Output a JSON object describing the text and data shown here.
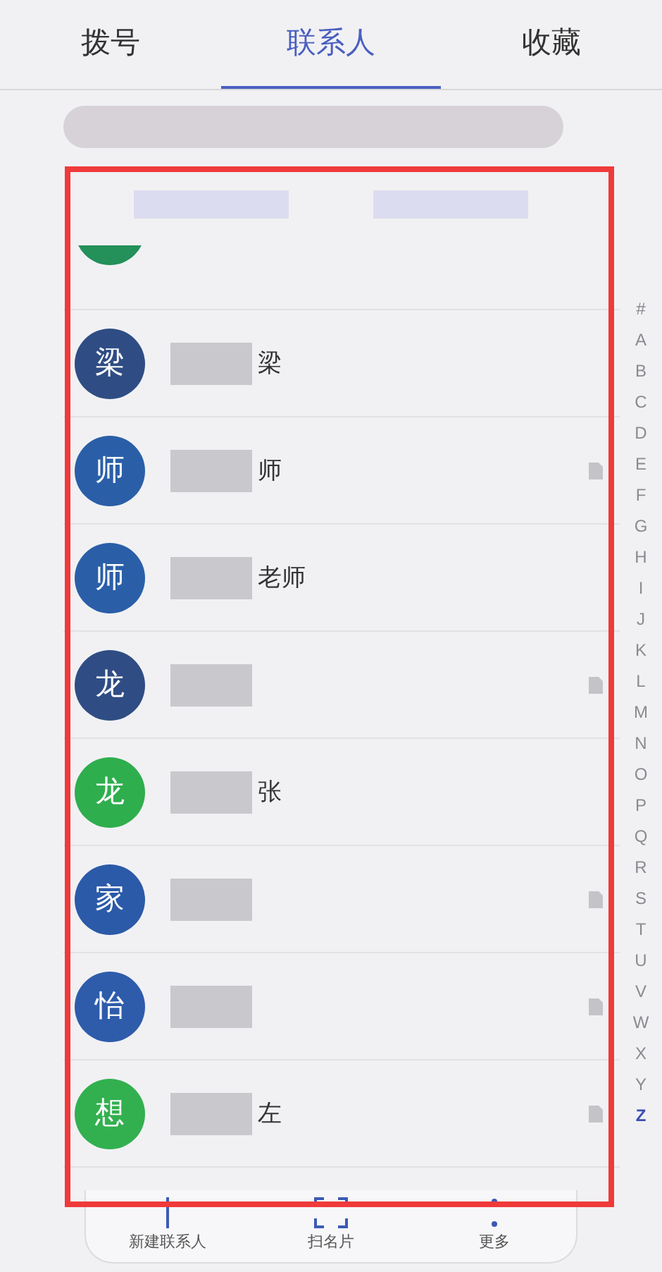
{
  "tabs": [
    {
      "label": "拨号",
      "selected": false
    },
    {
      "label": "联系人",
      "selected": true
    },
    {
      "label": "收藏",
      "selected": false
    }
  ],
  "partial_row": {
    "color": "#24905a"
  },
  "contacts": [
    {
      "avatar": "梁",
      "color": "#2f4d84",
      "name": "梁",
      "card": false
    },
    {
      "avatar": "师",
      "color": "#2a5fa8",
      "name": "师",
      "card": true
    },
    {
      "avatar": "师",
      "color": "#2a5fa8",
      "name": "老师",
      "card": false
    },
    {
      "avatar": "龙",
      "color": "#2f4d84",
      "card": true
    },
    {
      "avatar": "龙",
      "color": "#2fae4e",
      "name": "张",
      "card": false
    },
    {
      "avatar": "家",
      "color": "#2b5aa8",
      "card": true
    },
    {
      "avatar": "怡",
      "color": "#2e5cab",
      "card": true
    },
    {
      "avatar": "想",
      "color": "#32b04f",
      "name": "左",
      "card": true
    }
  ],
  "index": [
    {
      "label": "#",
      "selected": false
    },
    {
      "label": "A",
      "selected": false
    },
    {
      "label": "B",
      "selected": false
    },
    {
      "label": "C",
      "selected": false
    },
    {
      "label": "D",
      "selected": false
    },
    {
      "label": "E",
      "selected": false
    },
    {
      "label": "F",
      "selected": false
    },
    {
      "label": "G",
      "selected": false
    },
    {
      "label": "H",
      "selected": false
    },
    {
      "label": "I",
      "selected": false
    },
    {
      "label": "J",
      "selected": false
    },
    {
      "label": "K",
      "selected": false
    },
    {
      "label": "L",
      "selected": false
    },
    {
      "label": "M",
      "selected": false
    },
    {
      "label": "N",
      "selected": false
    },
    {
      "label": "O",
      "selected": false
    },
    {
      "label": "P",
      "selected": false
    },
    {
      "label": "Q",
      "selected": false
    },
    {
      "label": "R",
      "selected": false
    },
    {
      "label": "S",
      "selected": false
    },
    {
      "label": "T",
      "selected": false
    },
    {
      "label": "U",
      "selected": false
    },
    {
      "label": "V",
      "selected": false
    },
    {
      "label": "W",
      "selected": false
    },
    {
      "label": "X",
      "selected": false
    },
    {
      "label": "Y",
      "selected": false
    },
    {
      "label": "Z",
      "selected": true
    }
  ],
  "bottom_bar": [
    {
      "kind": "add",
      "label": "新建联系人"
    },
    {
      "kind": "scan",
      "label": "扫名片"
    },
    {
      "kind": "more",
      "label": "更多"
    }
  ]
}
